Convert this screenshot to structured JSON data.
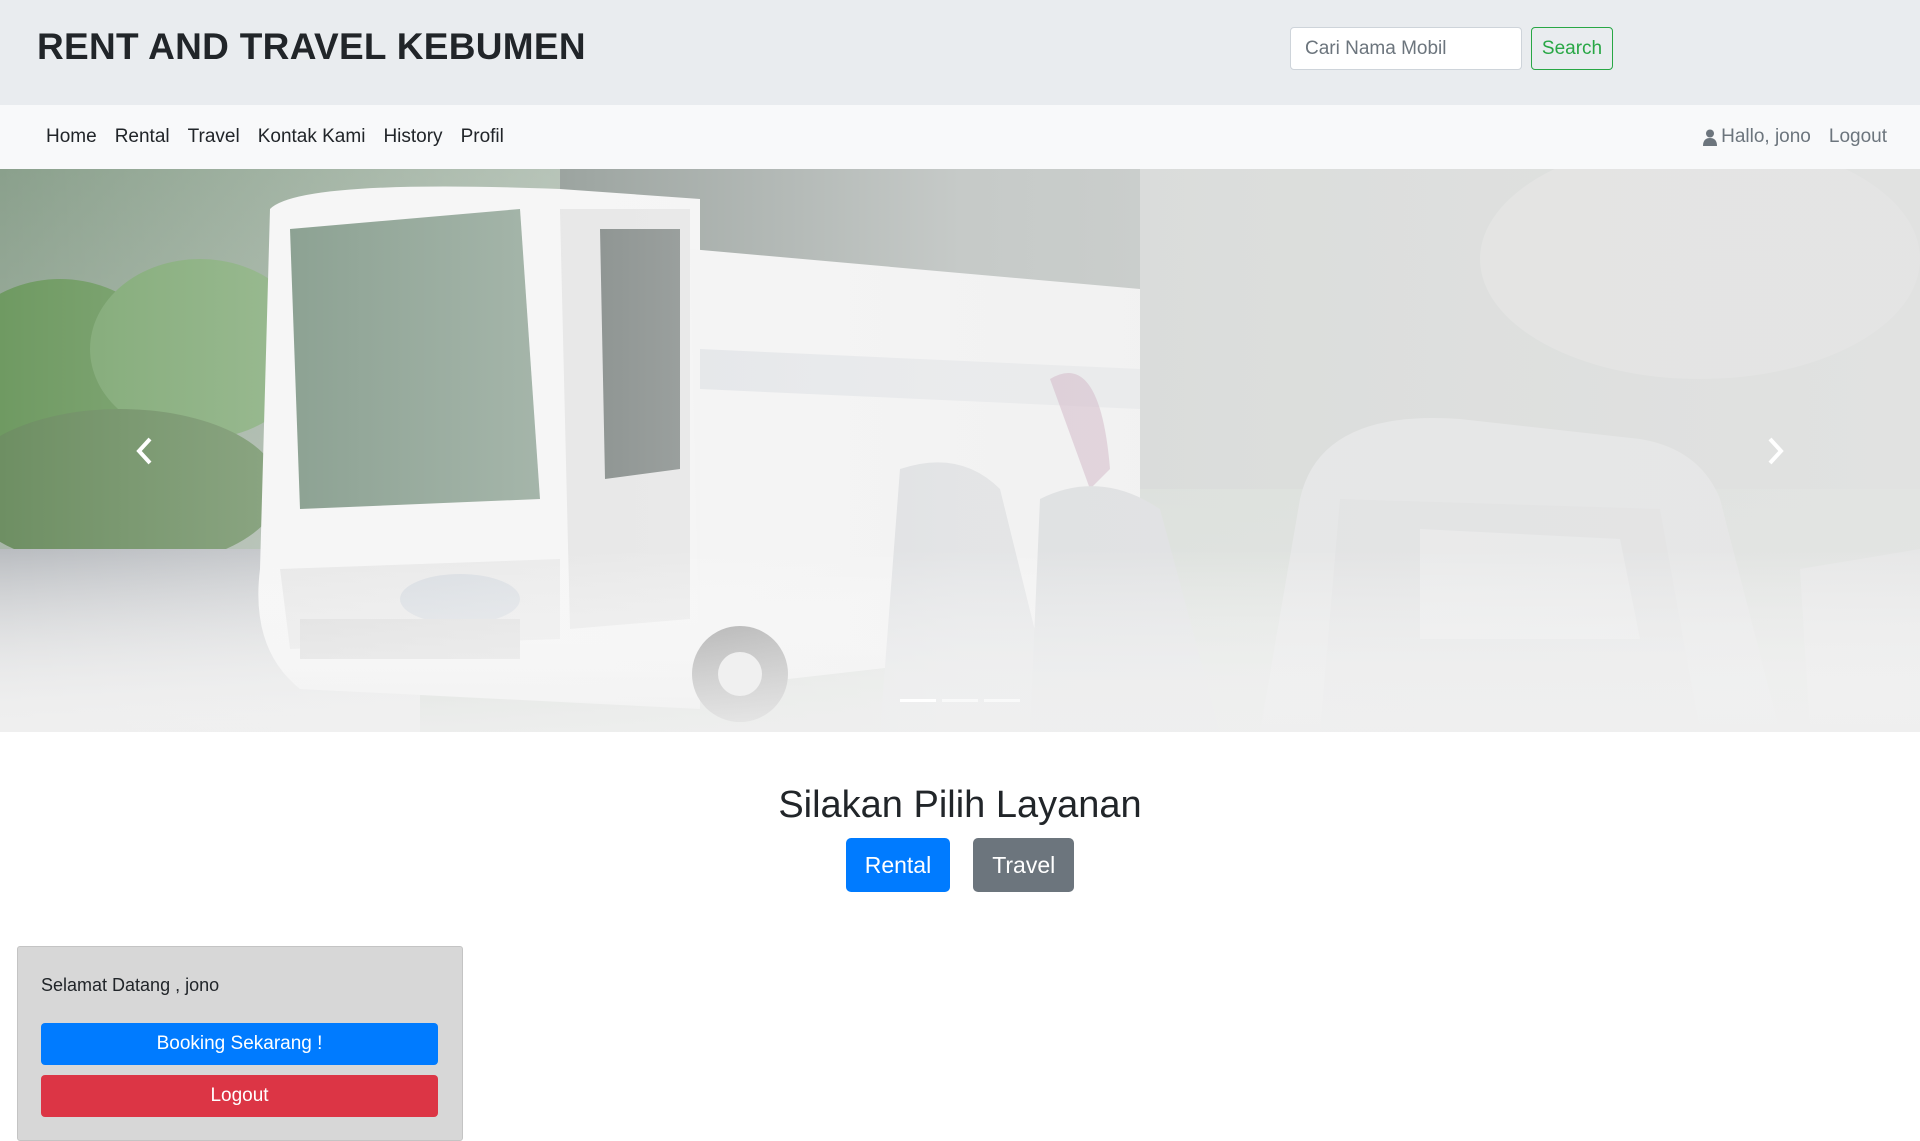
{
  "header": {
    "brand": "RENT AND TRAVEL KEBUMEN",
    "search_placeholder": "Cari Nama Mobil",
    "search_button": "Search"
  },
  "nav": {
    "items": [
      {
        "label": "Home"
      },
      {
        "label": "Rental"
      },
      {
        "label": "Travel"
      },
      {
        "label": "Kontak Kami"
      },
      {
        "label": "History"
      },
      {
        "label": "Profil"
      }
    ],
    "user_greeting": "Hallo, jono",
    "logout": "Logout"
  },
  "carousel": {
    "slide_count": 3,
    "active_slide": 1,
    "prev_icon": "chevron-left-icon",
    "next_icon": "chevron-right-icon"
  },
  "services": {
    "title": "Silakan Pilih Layanan",
    "rental_button": "Rental",
    "travel_button": "Travel"
  },
  "welcome_card": {
    "greeting": "Selamat Datang , jono",
    "booking_button": "Booking Sekarang !",
    "logout_button": "Logout"
  },
  "colors": {
    "header_bg": "#e9ecef",
    "navbar_bg": "#f8f9fa",
    "primary": "#007bff",
    "secondary": "#6c757d",
    "success": "#28a745",
    "danger": "#dc3545",
    "card_bg": "#d7d7d7"
  }
}
